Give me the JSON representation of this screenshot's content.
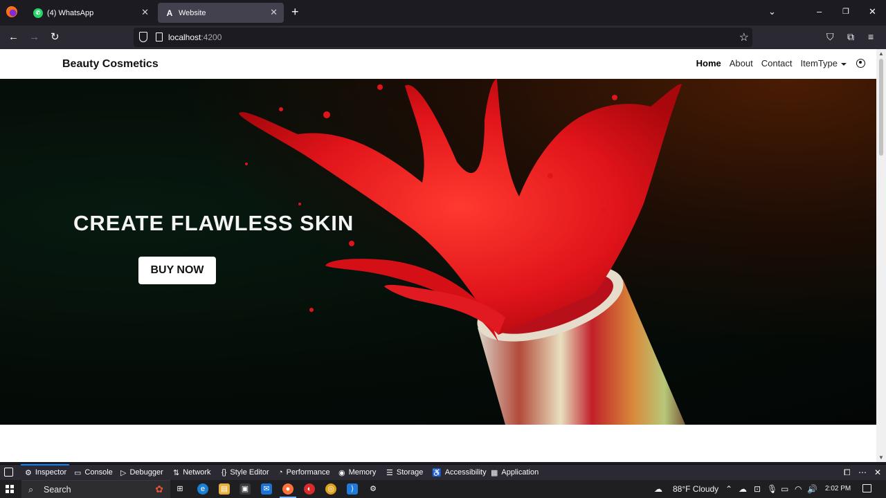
{
  "browser": {
    "tabs": [
      {
        "title": "(4) WhatsApp",
        "icon": "whatsapp-icon",
        "active": false
      },
      {
        "title": "Website",
        "icon": "angular-icon",
        "active": true
      }
    ],
    "url": {
      "host": "localhost",
      "port": ":4200"
    }
  },
  "site": {
    "brand": "Beauty Cosmetics",
    "nav": [
      {
        "label": "Home",
        "active": true
      },
      {
        "label": "About",
        "active": false
      },
      {
        "label": "Contact",
        "active": false
      },
      {
        "label": "ItemType",
        "active": false
      }
    ],
    "hero": {
      "headline": "CREATE FLAWLESS SKIN",
      "cta": "BUY NOW"
    }
  },
  "devtools": {
    "tabs": [
      "Inspector",
      "Console",
      "Debugger",
      "Network",
      "Style Editor",
      "Performance",
      "Memory",
      "Storage",
      "Accessibility",
      "Application"
    ],
    "active": "Inspector"
  },
  "taskbar": {
    "search_placeholder": "Search",
    "weather": "88°F  Cloudy",
    "time": "2:02 PM"
  },
  "colors": {
    "accent": "#0a84ff",
    "lipstick_red": "#e0141a",
    "hero_dark": "#040806"
  }
}
